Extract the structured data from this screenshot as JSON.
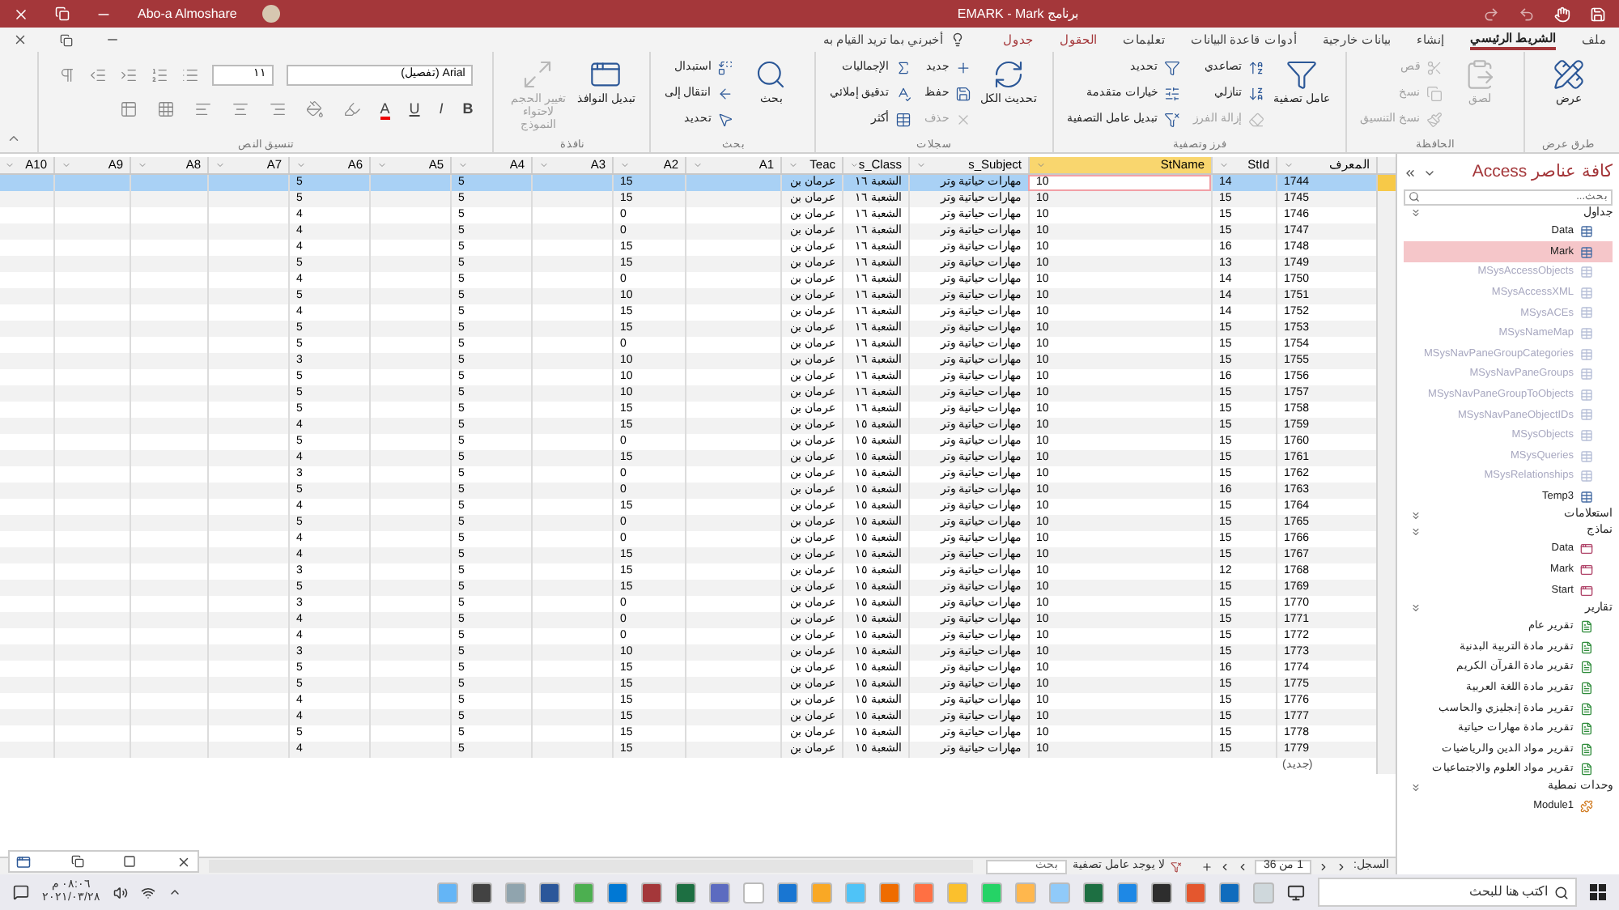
{
  "window": {
    "title": "برنامج EMARK - Mark",
    "user": "Abo-a Almoshare"
  },
  "tabs": [
    {
      "label": "ملف",
      "selected": false,
      "contextual": false
    },
    {
      "label": "الشريط الرئيسي",
      "selected": true,
      "contextual": false
    },
    {
      "label": "إنشاء",
      "selected": false,
      "contextual": false
    },
    {
      "label": "بيانات خارجية",
      "selected": false,
      "contextual": false
    },
    {
      "label": "أدوات قاعدة البيانات",
      "selected": false,
      "contextual": false
    },
    {
      "label": "تعليمات",
      "selected": false,
      "contextual": false
    },
    {
      "label": "الحقول",
      "selected": false,
      "contextual": true
    },
    {
      "label": "جدول",
      "selected": false,
      "contextual": true
    }
  ],
  "tell_me": {
    "placeholder": "أخبرني بما تريد القيام به"
  },
  "ribbon_groups": [
    {
      "kind": "buttons",
      "label": "طرق عرض",
      "items": [
        {
          "label": "عرض",
          "kind": "large",
          "disabled": false
        }
      ]
    },
    {
      "kind": "buttons",
      "label": "الحافظة",
      "items": [
        {
          "label": "لصق",
          "kind": "large",
          "disabled": true
        },
        {
          "label": "قص",
          "kind": "small",
          "disabled": true
        },
        {
          "label": "نسخ",
          "kind": "small",
          "disabled": true
        },
        {
          "label": "نسخ التنسيق",
          "kind": "small",
          "disabled": true
        }
      ]
    },
    {
      "kind": "buttons",
      "label": "فرز وتصفية",
      "items": [
        {
          "label": "عامل تصفية",
          "kind": "large",
          "disabled": false
        },
        {
          "label": "تصاعدي",
          "kind": "small",
          "disabled": false
        },
        {
          "label": "تنازلي",
          "kind": "small",
          "disabled": false
        },
        {
          "label": "إزالة الفرز",
          "kind": "small",
          "disabled": true
        },
        {
          "label": "تحديد",
          "kind": "small",
          "disabled": false
        },
        {
          "label": "خيارات متقدمة",
          "kind": "small",
          "disabled": false
        },
        {
          "label": "تبديل عامل التصفية",
          "kind": "small",
          "disabled": false
        }
      ]
    },
    {
      "kind": "buttons",
      "label": "سجلات",
      "items": [
        {
          "label": "تحديث الكل",
          "kind": "large",
          "disabled": false
        },
        {
          "label": "جديد",
          "kind": "small",
          "disabled": false
        },
        {
          "label": "حفظ",
          "kind": "small",
          "disabled": false
        },
        {
          "label": "حذف",
          "kind": "small",
          "disabled": true
        },
        {
          "label": "الإجماليات",
          "kind": "small",
          "disabled": false
        },
        {
          "label": "تدقيق إملائي",
          "kind": "small",
          "disabled": false
        },
        {
          "label": "أكثر",
          "kind": "small",
          "disabled": false
        }
      ]
    },
    {
      "kind": "buttons",
      "label": "بحث",
      "items": [
        {
          "label": "بحث",
          "kind": "large",
          "disabled": false
        },
        {
          "label": "استبدال",
          "kind": "small",
          "disabled": false
        },
        {
          "label": "انتقال إلى",
          "kind": "small",
          "disabled": false
        },
        {
          "label": "تحديد",
          "kind": "small",
          "disabled": false
        }
      ]
    },
    {
      "kind": "buttons",
      "label": "نافذة",
      "items": [
        {
          "label": "تبديل النوافذ",
          "kind": "large",
          "disabled": false
        },
        {
          "label": "تغيير الحجم لاحتواء النموذج",
          "kind": "large",
          "disabled": true
        }
      ]
    },
    {
      "kind": "text_format",
      "label": "تنسيق النص",
      "font": "Arial (تفصيل)",
      "font_size": "١١",
      "letters": [
        "B",
        "I",
        "U",
        "A"
      ]
    }
  ],
  "table": {
    "columns": [
      {
        "label": "المعرف",
        "selected": false
      },
      {
        "label": "StId",
        "selected": false
      },
      {
        "label": "StName",
        "selected": true
      },
      {
        "label": "s_Subject",
        "selected": false
      },
      {
        "label": "s_Class",
        "selected": false
      },
      {
        "label": "Teac",
        "selected": false
      },
      {
        "label": "A1",
        "selected": false
      },
      {
        "label": "A2",
        "selected": false
      },
      {
        "label": "A3",
        "selected": false
      },
      {
        "label": "A4",
        "selected": false
      },
      {
        "label": "A5",
        "selected": false
      },
      {
        "label": "A6",
        "selected": false
      },
      {
        "label": "A7",
        "selected": false
      },
      {
        "label": "A8",
        "selected": false
      },
      {
        "label": "A9",
        "selected": false
      },
      {
        "label": "A10",
        "selected": false
      }
    ],
    "rows": [
      {
        "id": "1744",
        "stid": "14",
        "stname": "10",
        "subject": "مهارات حياتية وتر",
        "class": "الشعبة ١٦",
        "teacher": "عرمان بن",
        "a2": "15",
        "a4": "5",
        "a6": "5",
        "selected": true
      },
      {
        "id": "1745",
        "stid": "15",
        "stname": "10",
        "subject": "مهارات حياتية وتر",
        "class": "الشعبة ١٦",
        "teacher": "عرمان بن",
        "a2": "15",
        "a4": "5",
        "a6": "5",
        "selected": false
      },
      {
        "id": "1746",
        "stid": "15",
        "stname": "10",
        "subject": "مهارات حياتية وتر",
        "class": "الشعبة ١٦",
        "teacher": "عرمان بن",
        "a2": "0",
        "a4": "5",
        "a6": "4",
        "selected": false
      },
      {
        "id": "1747",
        "stid": "15",
        "stname": "10",
        "subject": "مهارات حياتية وتر",
        "class": "الشعبة ١٦",
        "teacher": "عرمان بن",
        "a2": "0",
        "a4": "5",
        "a6": "4",
        "selected": false
      },
      {
        "id": "1748",
        "stid": "16",
        "stname": "10",
        "subject": "مهارات حياتية وتر",
        "class": "الشعبة ١٦",
        "teacher": "عرمان بن",
        "a2": "15",
        "a4": "5",
        "a6": "4",
        "selected": false
      },
      {
        "id": "1749",
        "stid": "13",
        "stname": "10",
        "subject": "مهارات حياتية وتر",
        "class": "الشعبة ١٦",
        "teacher": "عرمان بن",
        "a2": "15",
        "a4": "5",
        "a6": "5",
        "selected": false
      },
      {
        "id": "1750",
        "stid": "14",
        "stname": "10",
        "subject": "مهارات حياتية وتر",
        "class": "الشعبة ١٦",
        "teacher": "عرمان بن",
        "a2": "0",
        "a4": "5",
        "a6": "4",
        "selected": false
      },
      {
        "id": "1751",
        "stid": "14",
        "stname": "10",
        "subject": "مهارات حياتية وتر",
        "class": "الشعبة ١٦",
        "teacher": "عرمان بن",
        "a2": "10",
        "a4": "5",
        "a6": "5",
        "selected": false
      },
      {
        "id": "1752",
        "stid": "14",
        "stname": "10",
        "subject": "مهارات حياتية وتر",
        "class": "الشعبة ١٦",
        "teacher": "عرمان بن",
        "a2": "15",
        "a4": "5",
        "a6": "4",
        "selected": false
      },
      {
        "id": "1753",
        "stid": "15",
        "stname": "10",
        "subject": "مهارات حياتية وتر",
        "class": "الشعبة ١٦",
        "teacher": "عرمان بن",
        "a2": "15",
        "a4": "5",
        "a6": "5",
        "selected": false
      },
      {
        "id": "1754",
        "stid": "15",
        "stname": "10",
        "subject": "مهارات حياتية وتر",
        "class": "الشعبة ١٦",
        "teacher": "عرمان بن",
        "a2": "0",
        "a4": "5",
        "a6": "5",
        "selected": false
      },
      {
        "id": "1755",
        "stid": "15",
        "stname": "10",
        "subject": "مهارات حياتية وتر",
        "class": "الشعبة ١٦",
        "teacher": "عرمان بن",
        "a2": "10",
        "a4": "5",
        "a6": "3",
        "selected": false
      },
      {
        "id": "1756",
        "stid": "16",
        "stname": "10",
        "subject": "مهارات حياتية وتر",
        "class": "الشعبة ١٦",
        "teacher": "عرمان بن",
        "a2": "10",
        "a4": "5",
        "a6": "5",
        "selected": false
      },
      {
        "id": "1757",
        "stid": "15",
        "stname": "10",
        "subject": "مهارات حياتية وتر",
        "class": "الشعبة ١٦",
        "teacher": "عرمان بن",
        "a2": "10",
        "a4": "5",
        "a6": "5",
        "selected": false
      },
      {
        "id": "1758",
        "stid": "15",
        "stname": "10",
        "subject": "مهارات حياتية وتر",
        "class": "الشعبة ١٦",
        "teacher": "عرمان بن",
        "a2": "15",
        "a4": "5",
        "a6": "5",
        "selected": false
      },
      {
        "id": "1759",
        "stid": "15",
        "stname": "10",
        "subject": "مهارات حياتية وتر",
        "class": "الشعبة ١٥",
        "teacher": "عرمان بن",
        "a2": "15",
        "a4": "5",
        "a6": "4",
        "selected": false
      },
      {
        "id": "1760",
        "stid": "15",
        "stname": "10",
        "subject": "مهارات حياتية وتر",
        "class": "الشعبة ١٥",
        "teacher": "عرمان بن",
        "a2": "0",
        "a4": "5",
        "a6": "5",
        "selected": false
      },
      {
        "id": "1761",
        "stid": "15",
        "stname": "10",
        "subject": "مهارات حياتية وتر",
        "class": "الشعبة ١٥",
        "teacher": "عرمان بن",
        "a2": "15",
        "a4": "5",
        "a6": "4",
        "selected": false
      },
      {
        "id": "1762",
        "stid": "15",
        "stname": "10",
        "subject": "مهارات حياتية وتر",
        "class": "الشعبة ١٥",
        "teacher": "عرمان بن",
        "a2": "0",
        "a4": "5",
        "a6": "3",
        "selected": false
      },
      {
        "id": "1763",
        "stid": "16",
        "stname": "10",
        "subject": "مهارات حياتية وتر",
        "class": "الشعبة ١٥",
        "teacher": "عرمان بن",
        "a2": "0",
        "a4": "5",
        "a6": "5",
        "selected": false
      },
      {
        "id": "1764",
        "stid": "15",
        "stname": "10",
        "subject": "مهارات حياتية وتر",
        "class": "الشعبة ١٥",
        "teacher": "عرمان بن",
        "a2": "15",
        "a4": "5",
        "a6": "4",
        "selected": false
      },
      {
        "id": "1765",
        "stid": "15",
        "stname": "10",
        "subject": "مهارات حياتية وتر",
        "class": "الشعبة ١٥",
        "teacher": "عرمان بن",
        "a2": "0",
        "a4": "5",
        "a6": "5",
        "selected": false
      },
      {
        "id": "1766",
        "stid": "15",
        "stname": "10",
        "subject": "مهارات حياتية وتر",
        "class": "الشعبة ١٥",
        "teacher": "عرمان بن",
        "a2": "0",
        "a4": "5",
        "a6": "4",
        "selected": false
      },
      {
        "id": "1767",
        "stid": "15",
        "stname": "10",
        "subject": "مهارات حياتية وتر",
        "class": "الشعبة ١٥",
        "teacher": "عرمان بن",
        "a2": "15",
        "a4": "5",
        "a6": "4",
        "selected": false
      },
      {
        "id": "1768",
        "stid": "12",
        "stname": "10",
        "subject": "مهارات حياتية وتر",
        "class": "الشعبة ١٥",
        "teacher": "عرمان بن",
        "a2": "15",
        "a4": "5",
        "a6": "3",
        "selected": false
      },
      {
        "id": "1769",
        "stid": "15",
        "stname": "10",
        "subject": "مهارات حياتية وتر",
        "class": "الشعبة ١٥",
        "teacher": "عرمان بن",
        "a2": "15",
        "a4": "5",
        "a6": "5",
        "selected": false
      },
      {
        "id": "1770",
        "stid": "15",
        "stname": "10",
        "subject": "مهارات حياتية وتر",
        "class": "الشعبة ١٥",
        "teacher": "عرمان بن",
        "a2": "0",
        "a4": "5",
        "a6": "3",
        "selected": false
      },
      {
        "id": "1771",
        "stid": "15",
        "stname": "10",
        "subject": "مهارات حياتية وتر",
        "class": "الشعبة ١٥",
        "teacher": "عرمان بن",
        "a2": "0",
        "a4": "5",
        "a6": "4",
        "selected": false
      },
      {
        "id": "1772",
        "stid": "15",
        "stname": "10",
        "subject": "مهارات حياتية وتر",
        "class": "الشعبة ١٥",
        "teacher": "عرمان بن",
        "a2": "0",
        "a4": "5",
        "a6": "4",
        "selected": false
      },
      {
        "id": "1773",
        "stid": "15",
        "stname": "10",
        "subject": "مهارات حياتية وتر",
        "class": "الشعبة ١٥",
        "teacher": "عرمان بن",
        "a2": "10",
        "a4": "5",
        "a6": "3",
        "selected": false
      },
      {
        "id": "1774",
        "stid": "16",
        "stname": "10",
        "subject": "مهارات حياتية وتر",
        "class": "الشعبة ١٥",
        "teacher": "عرمان بن",
        "a2": "15",
        "a4": "5",
        "a6": "5",
        "selected": false
      },
      {
        "id": "1775",
        "stid": "15",
        "stname": "10",
        "subject": "مهارات حياتية وتر",
        "class": "الشعبة ١٥",
        "teacher": "عرمان بن",
        "a2": "15",
        "a4": "5",
        "a6": "5",
        "selected": false
      },
      {
        "id": "1776",
        "stid": "15",
        "stname": "10",
        "subject": "مهارات حياتية وتر",
        "class": "الشعبة ١٥",
        "teacher": "عرمان بن",
        "a2": "15",
        "a4": "5",
        "a6": "4",
        "selected": false
      },
      {
        "id": "1777",
        "stid": "15",
        "stname": "10",
        "subject": "مهارات حياتية وتر",
        "class": "الشعبة ١٥",
        "teacher": "عرمان بن",
        "a2": "15",
        "a4": "5",
        "a6": "4",
        "selected": false
      },
      {
        "id": "1778",
        "stid": "15",
        "stname": "10",
        "subject": "مهارات حياتية وتر",
        "class": "الشعبة ١٥",
        "teacher": "عرمان بن",
        "a2": "15",
        "a4": "5",
        "a6": "5",
        "selected": false
      },
      {
        "id": "1779",
        "stid": "15",
        "stname": "10",
        "subject": "مهارات حياتية وتر",
        "class": "الشعبة ١٥",
        "teacher": "عرمان بن",
        "a2": "15",
        "a4": "5",
        "a6": "4",
        "selected": false
      }
    ],
    "new_row": "(جديد)"
  },
  "status_bar": {
    "record_label": "السجل:",
    "position": "1 من 36",
    "filter": "لا يوجد عامل تصفية",
    "search": {
      "placeholder": "بحث"
    }
  },
  "nav_pane": {
    "title": "كافة عناصر Access",
    "search": {
      "placeholder": "بحث..."
    },
    "groups": [
      {
        "label": "جداول",
        "kind": "tables",
        "items": [
          {
            "label": "Data",
            "hidden": false,
            "selected": false
          },
          {
            "label": "Mark",
            "hidden": false,
            "selected": true
          },
          {
            "label": "MSysAccessObjects",
            "hidden": true,
            "selected": false
          },
          {
            "label": "MSysAccessXML",
            "hidden": true,
            "selected": false
          },
          {
            "label": "MSysACEs",
            "hidden": true,
            "selected": false
          },
          {
            "label": "MSysNameMap",
            "hidden": true,
            "selected": false
          },
          {
            "label": "MSysNavPaneGroupCategories",
            "hidden": true,
            "selected": false
          },
          {
            "label": "MSysNavPaneGroups",
            "hidden": true,
            "selected": false
          },
          {
            "label": "MSysNavPaneGroupToObjects",
            "hidden": true,
            "selected": false
          },
          {
            "label": "MSysNavPaneObjectIDs",
            "hidden": true,
            "selected": false
          },
          {
            "label": "MSysObjects",
            "hidden": true,
            "selected": false
          },
          {
            "label": "MSysQueries",
            "hidden": true,
            "selected": false
          },
          {
            "label": "MSysRelationships",
            "hidden": true,
            "selected": false
          },
          {
            "label": "Temp3",
            "hidden": false,
            "selected": false
          }
        ]
      },
      {
        "label": "استعلامات"
      },
      {
        "label": "نماذج",
        "kind": "forms",
        "items": [
          {
            "label": "Data",
            "hidden": false,
            "selected": false
          },
          {
            "label": "Mark",
            "hidden": false,
            "selected": false
          },
          {
            "label": "Start",
            "hidden": false,
            "selected": false
          }
        ]
      },
      {
        "label": "تقارير",
        "kind": "reports",
        "items": [
          {
            "label": "تقرير عام",
            "hidden": false,
            "selected": false
          },
          {
            "label": "تقرير مادة التربية البدنية",
            "hidden": false,
            "selected": false
          },
          {
            "label": "تقرير مادة القرآن الكريم",
            "hidden": false,
            "selected": false
          },
          {
            "label": "تقرير مادة اللغة العربية",
            "hidden": false,
            "selected": false
          },
          {
            "label": "تقرير مادة إنجليزي والحاسب",
            "hidden": false,
            "selected": false
          },
          {
            "label": "تقرير مادة مهارات حياتية",
            "hidden": false,
            "selected": false
          },
          {
            "label": "تقرير مواد الدين والرياضيات",
            "hidden": false,
            "selected": false
          },
          {
            "label": "تقرير مواد العلوم والاجتماعيات",
            "hidden": false,
            "selected": false
          }
        ]
      },
      {
        "label": "وحدات نمطية",
        "kind": "modules",
        "items": [
          {
            "label": "Module1",
            "hidden": false,
            "selected": false
          }
        ]
      }
    ]
  },
  "taskbar": {
    "search": {
      "placeholder": "اكتب هنا للبحث"
    },
    "time": "٠٨:٠٦ م",
    "date": "٢٠٢١/٠٣/٢٨"
  }
}
